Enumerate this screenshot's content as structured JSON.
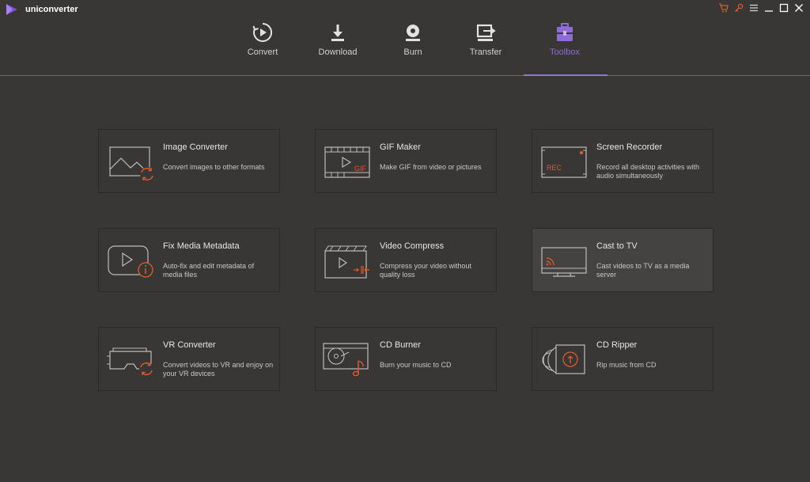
{
  "app": {
    "title": "uniconverter"
  },
  "nav": [
    {
      "label": "Convert",
      "icon": "convert-icon"
    },
    {
      "label": "Download",
      "icon": "download-icon"
    },
    {
      "label": "Burn",
      "icon": "burn-icon"
    },
    {
      "label": "Transfer",
      "icon": "transfer-icon"
    },
    {
      "label": "Toolbox",
      "icon": "toolbox-icon",
      "active": true
    }
  ],
  "tools": [
    {
      "title": "Image Converter",
      "desc": "Convert images to other formats",
      "icon": "image-converter-icon"
    },
    {
      "title": "GIF Maker",
      "desc": "Make GIF from video or pictures",
      "icon": "gif-maker-icon"
    },
    {
      "title": "Screen Recorder",
      "desc": "Record all desktop activities with audio simultaneously",
      "icon": "screen-recorder-icon"
    },
    {
      "title": "Fix Media Metadata",
      "desc": "Auto-fix and edit metadata of media files",
      "icon": "fix-metadata-icon"
    },
    {
      "title": "Video Compress",
      "desc": "Compress your video without quality loss",
      "icon": "video-compress-icon"
    },
    {
      "title": "Cast to TV",
      "desc": "Cast videos to TV as a media server",
      "icon": "cast-tv-icon"
    },
    {
      "title": "VR Converter",
      "desc": "Convert videos to VR and enjoy on your VR devices",
      "icon": "vr-converter-icon"
    },
    {
      "title": "CD Burner",
      "desc": "Burn your music to CD",
      "icon": "cd-burner-icon"
    },
    {
      "title": "CD Ripper",
      "desc": "Rip music from CD",
      "icon": "cd-ripper-icon"
    }
  ],
  "icon_labels": {
    "rec": "REC",
    "gif": "GIF"
  },
  "colors": {
    "accent": "#8f6bd6",
    "orange": "#e05a2b",
    "background": "#393636"
  }
}
